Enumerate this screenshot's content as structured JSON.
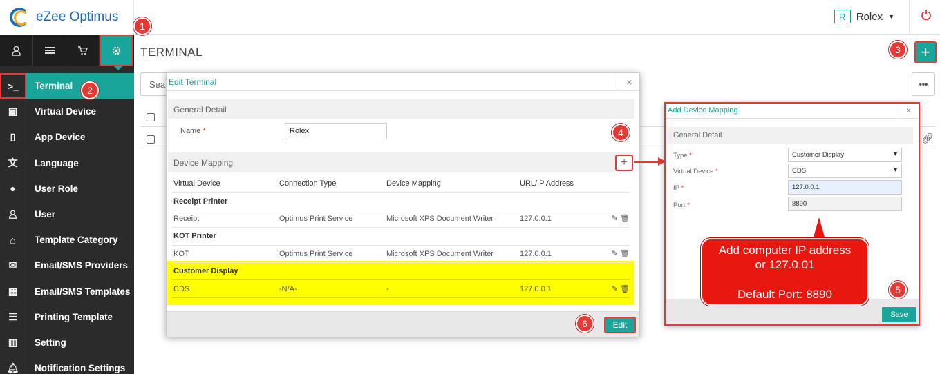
{
  "brand": {
    "name": "eZee Optimus"
  },
  "header": {
    "user_initial": "R",
    "user_name": "Rolex"
  },
  "topbar_icons": [
    "user-icon",
    "menu-icon",
    "cart-icon",
    "gear-icon"
  ],
  "nav": [
    {
      "label": "Terminal",
      "icon": "terminal-icon"
    },
    {
      "label": "Virtual Device",
      "icon": "tablet-icon"
    },
    {
      "label": "App Device",
      "icon": "mobile-icon"
    },
    {
      "label": "Language",
      "icon": "language-icon"
    },
    {
      "label": "User Role",
      "icon": "user-role-icon"
    },
    {
      "label": "User",
      "icon": "user-icon"
    },
    {
      "label": "Template Category",
      "icon": "inbox-icon"
    },
    {
      "label": "Email/SMS Providers",
      "icon": "envelope-icon"
    },
    {
      "label": "Email/SMS Templates",
      "icon": "calendar-icon"
    },
    {
      "label": "Printing Template",
      "icon": "document-icon"
    },
    {
      "label": "Setting",
      "icon": "setting-icon"
    },
    {
      "label": "Notification Settings",
      "icon": "bell-icon"
    }
  ],
  "page": {
    "title": "TERMINAL",
    "search_placeholder": "Sea",
    "more": "•••",
    "add": "+"
  },
  "steps": [
    "1",
    "2",
    "3",
    "4",
    "5",
    "6"
  ],
  "edit_modal": {
    "title": "Edit Terminal",
    "close": "×",
    "general_detail": "General Detail",
    "name_label": "Name",
    "name_value": "Rolex",
    "device_mapping": "Device Mapping",
    "add": "+",
    "columns": [
      "Virtual Device",
      "Connection Type",
      "Device Mapping",
      "URL/IP Address"
    ],
    "groups": [
      {
        "name": "Receipt Printer",
        "row": [
          "Receipt",
          "Optimus Print Service",
          "Microsoft XPS Document Writer",
          "127.0.0.1"
        ]
      },
      {
        "name": "KOT Printer",
        "row": [
          "KOT",
          "Optimus Print Service",
          "Microsoft XPS Document Writer",
          "127.0.0.1"
        ]
      },
      {
        "name": "Customer Display",
        "row": [
          "CDS",
          "-N/A-",
          "-",
          "127.0.0.1"
        ]
      }
    ],
    "edit_button": "Edit"
  },
  "mapping_modal": {
    "title": "Add Device Mapping",
    "close": "×",
    "general_detail": "General Detail",
    "type_label": "Type",
    "type_value": "Customer Display",
    "virtual_device_label": "Virtual Device",
    "virtual_device_value": "CDS",
    "ip_label": "IP",
    "ip_value": "127.0.0.1",
    "port_label": "Port",
    "port_value": "8890",
    "save_button": "Save"
  },
  "callout": {
    "line1": "Add computer IP address",
    "line2": "or 127.0.01",
    "line3": "Default Port: 8890"
  },
  "colors": {
    "accent": "#1aa59a",
    "marker": "#e53935",
    "highlight": "#ffff00",
    "sidebar": "#2b2b2b"
  }
}
